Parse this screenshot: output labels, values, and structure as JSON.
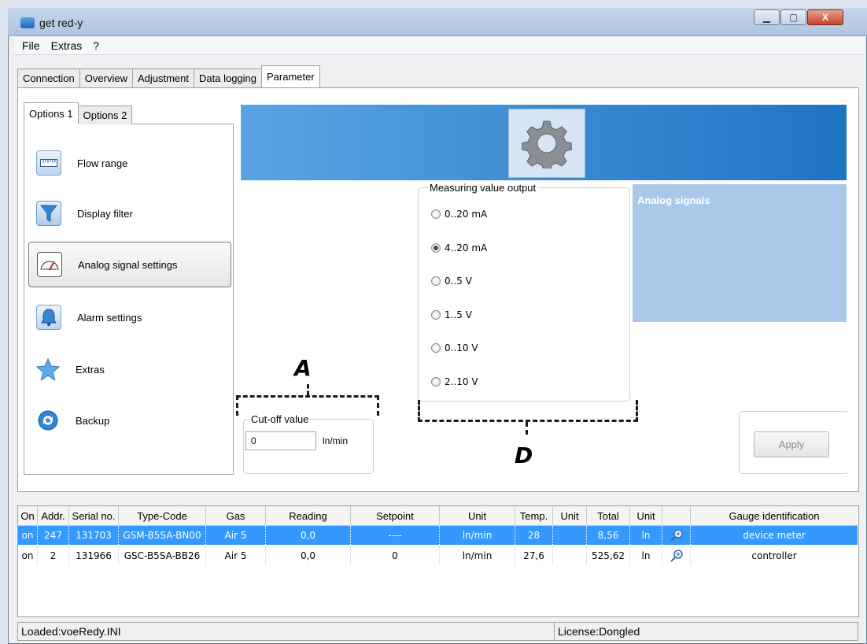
{
  "window": {
    "title": "get red-y",
    "min_glyph": "▁",
    "max_glyph": "▢",
    "close_glyph": "X"
  },
  "menu": [
    "File",
    "Extras",
    "?"
  ],
  "tabs": [
    "Connection",
    "Overview",
    "Adjustment",
    "Data logging",
    "Parameter"
  ],
  "subtabs": [
    "Options 1",
    "Options 2"
  ],
  "options": [
    {
      "label": "Flow range",
      "icon": "ruler-icon"
    },
    {
      "label": "Display filter",
      "icon": "funnel-icon"
    },
    {
      "label": "Analog signal settings",
      "icon": "gauge-icon"
    },
    {
      "label": "Alarm settings",
      "icon": "bell-icon"
    },
    {
      "label": "Extras",
      "icon": "star-icon"
    },
    {
      "label": "Backup",
      "icon": "backup-icon"
    }
  ],
  "measuring": {
    "title": "Measuring value output",
    "options": [
      "0..20 mA",
      "4..20 mA",
      "0..5  V",
      "1..5 V",
      "0..10  V",
      "2..10 V"
    ],
    "selected": "4..20 mA"
  },
  "info_title": "Analog signals",
  "cutoff": {
    "title": "Cut-off value",
    "value": "0",
    "unit": "ln/min"
  },
  "annotations": {
    "a": "A",
    "d": "D"
  },
  "apply_label": "Apply",
  "table": {
    "headers": [
      "On",
      "Addr.",
      "Serial no.",
      "Type-Code",
      "Gas",
      "Reading",
      "Setpoint",
      "Unit",
      "Temp.",
      "Unit",
      "Total",
      "Unit",
      "",
      "Gauge identification"
    ],
    "rows": [
      [
        "on",
        "247",
        "131703",
        "GSM-B5SA-BN00",
        "Air 5",
        "0,0",
        "----",
        "ln/min",
        "28",
        "",
        "8,56",
        "ln",
        "",
        "device meter"
      ],
      [
        "on",
        "2",
        "131966",
        "GSC-B5SA-BB26",
        "Air 5",
        "0,0",
        "0",
        "ln/min",
        "27,6",
        "",
        "525,62",
        "ln",
        "",
        "controller"
      ]
    ]
  },
  "status": {
    "left": "Loaded:voeRedy.INI",
    "right": "License:Dongled"
  },
  "colors": {
    "banner": "#1f74c3",
    "info_panel": "#a9c8ea",
    "row_selected": "#3399ff"
  }
}
